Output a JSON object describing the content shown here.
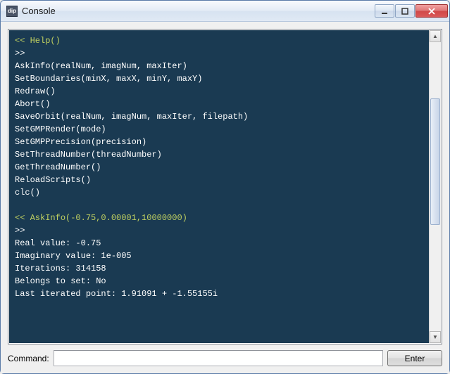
{
  "window": {
    "title": "Console",
    "icon_text": "dip"
  },
  "console": {
    "lines": [
      {
        "type": "cmd",
        "prompt": "<<",
        "text": "Help()"
      },
      {
        "type": "out",
        "text": ">>"
      },
      {
        "type": "out",
        "text": "AskInfo(realNum, imagNum, maxIter)"
      },
      {
        "type": "out",
        "text": "SetBoundaries(minX, maxX, minY, maxY)"
      },
      {
        "type": "out",
        "text": "Redraw()"
      },
      {
        "type": "out",
        "text": "Abort()"
      },
      {
        "type": "out",
        "text": "SaveOrbit(realNum, imagNum, maxIter, filepath)"
      },
      {
        "type": "out",
        "text": "SetGMPRender(mode)"
      },
      {
        "type": "out",
        "text": "SetGMPPrecision(precision)"
      },
      {
        "type": "out",
        "text": "SetThreadNumber(threadNumber)"
      },
      {
        "type": "out",
        "text": "GetThreadNumber()"
      },
      {
        "type": "out",
        "text": "ReloadScripts()"
      },
      {
        "type": "out",
        "text": "clc()"
      },
      {
        "type": "blank",
        "text": ""
      },
      {
        "type": "cmd",
        "prompt": "<<",
        "text": "AskInfo(-0.75,0.00001,10000000)"
      },
      {
        "type": "out",
        "text": ">>"
      },
      {
        "type": "out",
        "text": "Real value: -0.75"
      },
      {
        "type": "out",
        "text": "Imaginary value: 1e-005"
      },
      {
        "type": "out",
        "text": "Iterations: 314158"
      },
      {
        "type": "out",
        "text": "Belongs to set: No"
      },
      {
        "type": "out",
        "text": "Last iterated point: 1.91091 + -1.55155i"
      }
    ]
  },
  "command": {
    "label": "Command:",
    "value": "",
    "placeholder": "",
    "enter_label": "Enter"
  }
}
